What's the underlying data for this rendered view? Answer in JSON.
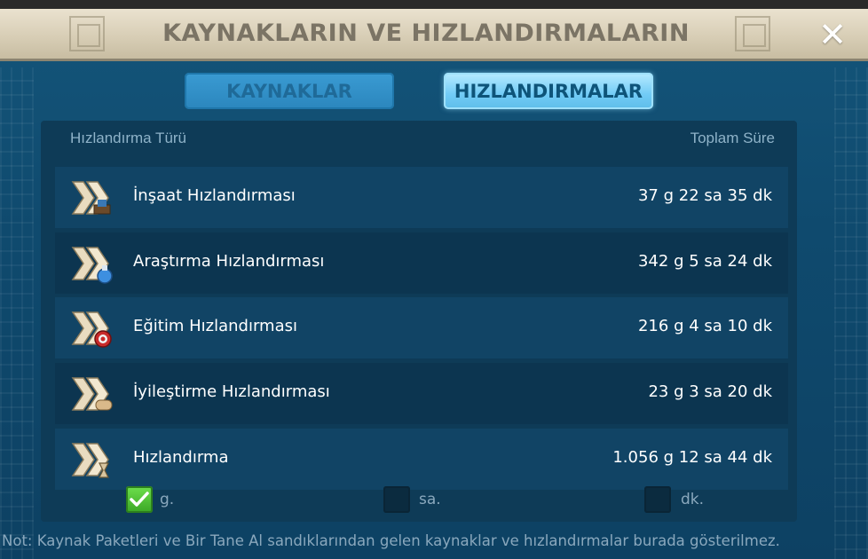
{
  "window": {
    "title": "KAYNAKLARIN VE HIZLANDIRMALARIN",
    "close_glyph": "✕"
  },
  "tabs": [
    {
      "label": "KAYNAKLAR",
      "active": false
    },
    {
      "label": "HIZLANDIRMALAR",
      "active": true
    }
  ],
  "table": {
    "header_type": "Hızlandırma Türü",
    "header_total": "Toplam Süre",
    "rows": [
      {
        "label": "İnşaat Hızlandırması",
        "value": "37 g 22 sa 35 dk",
        "icon": "construction-speedup-icon"
      },
      {
        "label": "Araştırma Hızlandırması",
        "value": "342 g 5 sa 24 dk",
        "icon": "research-speedup-icon"
      },
      {
        "label": "Eğitim Hızlandırması",
        "value": "216 g 4 sa 10 dk",
        "icon": "training-speedup-icon"
      },
      {
        "label": "İyileştirme Hızlandırması",
        "value": "23 g 3 sa 20 dk",
        "icon": "healing-speedup-icon"
      },
      {
        "label": "Hızlandırma",
        "value": "1.056 g 12 sa 44 dk",
        "icon": "universal-speedup-icon"
      }
    ]
  },
  "units": [
    {
      "label": "g.",
      "checked": true
    },
    {
      "label": "sa.",
      "checked": false
    },
    {
      "label": "dk.",
      "checked": false
    }
  ],
  "note": "Not: Kaynak Paketleri ve Bir Tane Al sandıklarından gelen kaynaklar ve hızlandırmalar burada gösterilmez.",
  "colors": {
    "panel_blue": "#0f4a6e",
    "active_tab": "#71cbf6",
    "check_green": "#3aa625"
  }
}
